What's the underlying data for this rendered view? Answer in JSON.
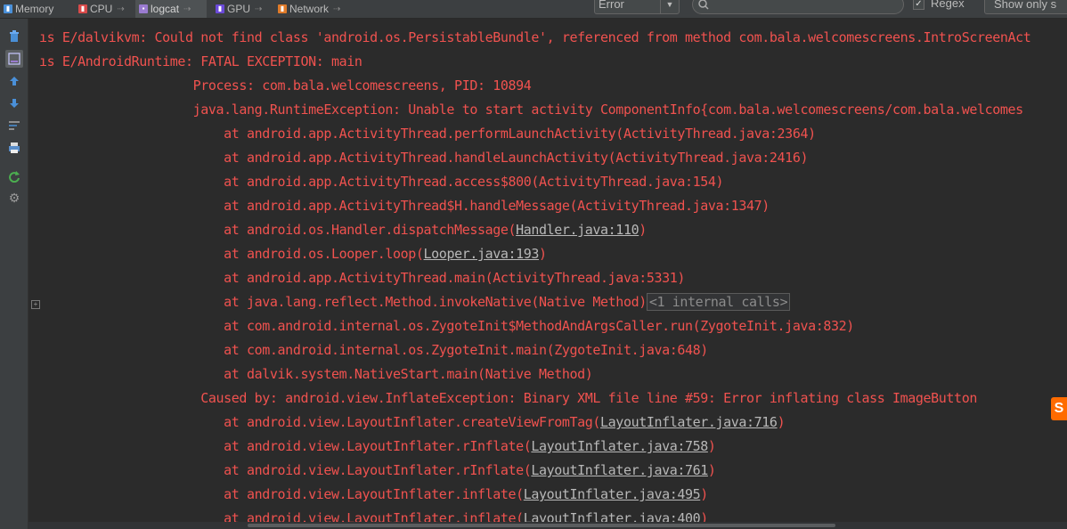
{
  "tabs": [
    {
      "label": "Memory",
      "icon": "memory-icon",
      "color": "#4a90d9",
      "active": false
    },
    {
      "label": "CPU",
      "icon": "cpu-icon",
      "color": "#d94a4a",
      "active": false
    },
    {
      "label": "logcat",
      "icon": "logcat-icon",
      "color": "#9a7bd0",
      "active": true
    },
    {
      "label": "GPU",
      "icon": "gpu-icon",
      "color": "#6b4ad9",
      "active": false
    },
    {
      "label": "Network",
      "icon": "network-icon",
      "color": "#e07b2a",
      "active": false
    }
  ],
  "filter": {
    "log_level": "Error",
    "search_value": "",
    "regex_label": "Regex",
    "regex_checked": true,
    "show_only_label": "Show only s"
  },
  "left_toolbar": [
    {
      "icon": "trash-icon"
    },
    {
      "icon": "scroll-to-end-icon"
    },
    {
      "icon": "arrow-up-icon"
    },
    {
      "icon": "arrow-down-icon"
    },
    {
      "icon": "soft-wrap-icon"
    },
    {
      "icon": "print-icon"
    },
    {
      "icon": "restart-icon"
    },
    {
      "icon": "gear-icon"
    }
  ],
  "log": {
    "l1": "ıs E/dalvikvm: Could not find class 'android.os.PersistableBundle', referenced from method com.bala.welcomescreens.IntroScreenAct",
    "l2": "ıs E/AndroidRuntime: FATAL EXCEPTION: main",
    "l3": "                    Process: com.bala.welcomescreens, PID: 10894",
    "l4": "                    java.lang.RuntimeException: Unable to start activity ComponentInfo{com.bala.welcomescreens/com.bala.welcomes",
    "l5": "                        at android.app.ActivityThread.performLaunchActivity(ActivityThread.java:2364)",
    "l6": "                        at android.app.ActivityThread.handleLaunchActivity(ActivityThread.java:2416)",
    "l7": "                        at android.app.ActivityThread.access$800(ActivityThread.java:154)",
    "l8": "                        at android.app.ActivityThread$H.handleMessage(ActivityThread.java:1347)",
    "l9a": "                        at android.os.Handler.dispatchMessage(",
    "l9b": "Handler.java:110",
    "l9c": ")",
    "l10a": "                        at android.os.Looper.loop(",
    "l10b": "Looper.java:193",
    "l10c": ")",
    "l11": "                        at android.app.ActivityThread.main(ActivityThread.java:5331)",
    "l12a": "                        at java.lang.reflect.Method.invokeNative(Native Method)",
    "l12b": "<1 internal calls>",
    "l13": "                        at com.android.internal.os.ZygoteInit$MethodAndArgsCaller.run(ZygoteInit.java:832)",
    "l14": "                        at com.android.internal.os.ZygoteInit.main(ZygoteInit.java:648)",
    "l15": "                        at dalvik.system.NativeStart.main(Native Method)",
    "l16": "                     Caused by: android.view.InflateException: Binary XML file line #59: Error inflating class ImageButton",
    "l17a": "                        at android.view.LayoutInflater.createViewFromTag(",
    "l17b": "LayoutInflater.java:716",
    "l17c": ")",
    "l18a": "                        at android.view.LayoutInflater.rInflate(",
    "l18b": "LayoutInflater.java:758",
    "l18c": ")",
    "l19a": "                        at android.view.LayoutInflater.rInflate(",
    "l19b": "LayoutInflater.java:761",
    "l19c": ")",
    "l20a": "                        at android.view.LayoutInflater.inflate(",
    "l20b": "LayoutInflater.java:495",
    "l20c": ")",
    "l21a": "                        at android.view.LayoutInflater.inflate(",
    "l21b": "LayoutInflater.java:400",
    "l21c": ")"
  },
  "overlay_badge": "S"
}
